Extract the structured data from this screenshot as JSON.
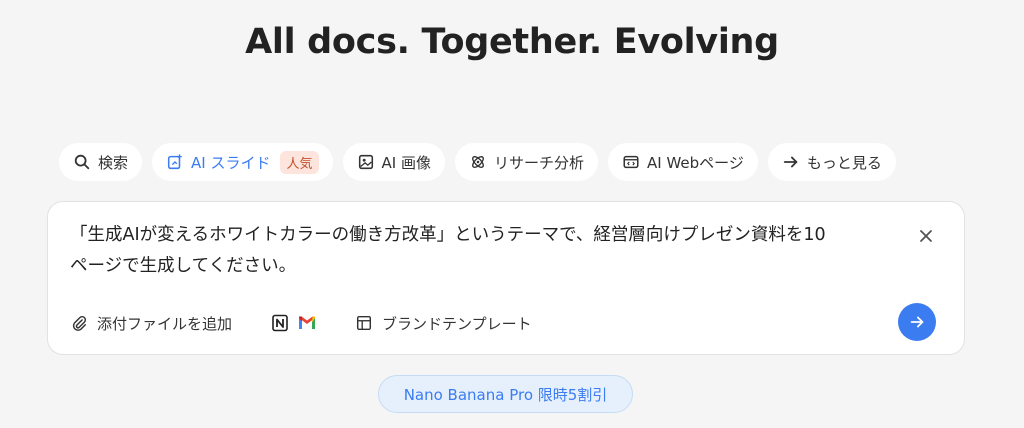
{
  "headline": "All docs. Together. Evolving",
  "tabs": [
    {
      "label": "検索",
      "icon": "search-icon"
    },
    {
      "label": "AI スライド",
      "icon": "slides-icon",
      "badge": "人気",
      "active": true
    },
    {
      "label": "AI 画像",
      "icon": "image-icon"
    },
    {
      "label": "リサーチ分析",
      "icon": "research-icon"
    },
    {
      "label": "AI Webページ",
      "icon": "webpage-icon"
    },
    {
      "label": "もっと見る",
      "icon": "arrow-right-icon"
    }
  ],
  "composer": {
    "prompt_line1": "「生成AIが変えるホワイトカラーの働き方改革」というテーマで、経営層向けプレゼン資料を10",
    "prompt_line2": "ページで生成してください。",
    "attach_label": "添付ファイルを追加",
    "brand_template_label": "ブランドテンプレート",
    "integrations": [
      "notion-icon",
      "gmail-icon"
    ]
  },
  "promo": "Nano Banana Pro 限時5割引",
  "colors": {
    "accent": "#3b7cf0",
    "badge_bg": "#fde4dc",
    "badge_text": "#c4502a",
    "background": "#f5f5f5"
  }
}
